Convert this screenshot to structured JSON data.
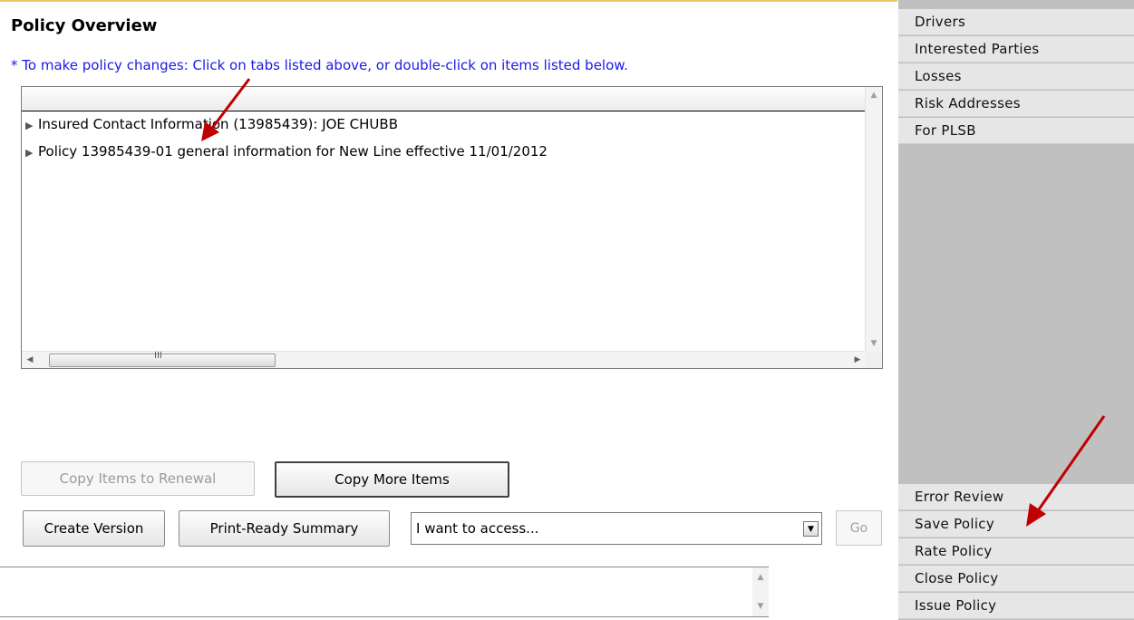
{
  "page": {
    "title": "Policy Overview",
    "hint": "* To make policy changes: Click on tabs listed above, or double-click on items listed below."
  },
  "overview_list": {
    "items": [
      {
        "label": "Insured Contact Information (13985439):  JOE CHUBB"
      },
      {
        "label": "Policy 13985439-01 general information for New Line effective 11/01/2012"
      }
    ],
    "scrollbar_grip": "III"
  },
  "actions": {
    "copy_items_to_renewal": "Copy Items to Renewal",
    "copy_more_items": "Copy More Items",
    "create_version": "Create Version",
    "print_ready_summary": "Print-Ready Summary",
    "access_select_value": "I want to access...",
    "go": "Go"
  },
  "sidebar": {
    "top_items": [
      {
        "label": "Drivers"
      },
      {
        "label": "Interested Parties"
      },
      {
        "label": "Losses"
      },
      {
        "label": "Risk Addresses"
      },
      {
        "label": "For PLSB"
      }
    ],
    "bottom_items": [
      {
        "label": "Error Review"
      },
      {
        "label": "Save Policy"
      },
      {
        "label": "Rate Policy"
      },
      {
        "label": "Close Policy"
      },
      {
        "label": "Issue Policy"
      }
    ]
  },
  "colors": {
    "hint": "#1a1ae6",
    "sidebar_bg": "#c0c0c0",
    "sidebar_item": "#e6e6e6",
    "annotation_arrow": "#c00000"
  }
}
